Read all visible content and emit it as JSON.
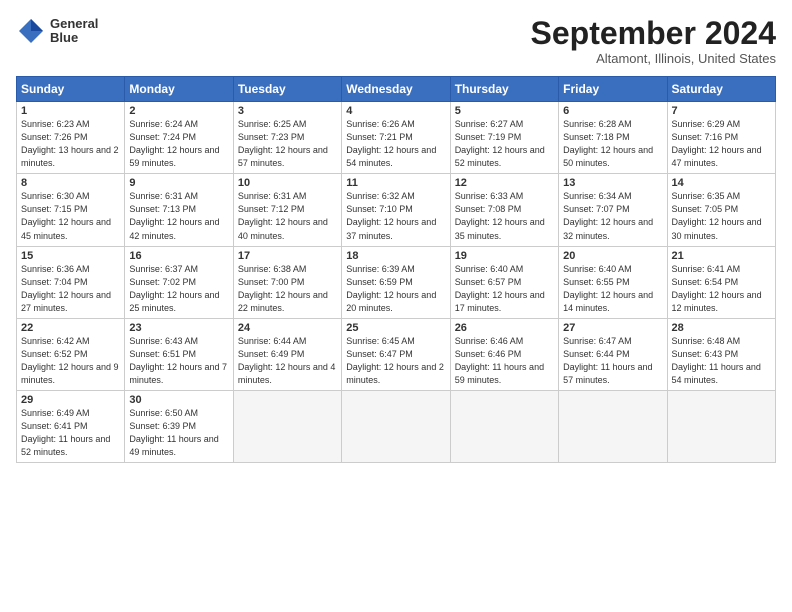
{
  "header": {
    "logo_line1": "General",
    "logo_line2": "Blue",
    "month_title": "September 2024",
    "location": "Altamont, Illinois, United States"
  },
  "weekdays": [
    "Sunday",
    "Monday",
    "Tuesday",
    "Wednesday",
    "Thursday",
    "Friday",
    "Saturday"
  ],
  "weeks": [
    [
      {
        "day": "1",
        "sunrise": "6:23 AM",
        "sunset": "7:26 PM",
        "daylight": "13 hours and 2 minutes."
      },
      {
        "day": "2",
        "sunrise": "6:24 AM",
        "sunset": "7:24 PM",
        "daylight": "12 hours and 59 minutes."
      },
      {
        "day": "3",
        "sunrise": "6:25 AM",
        "sunset": "7:23 PM",
        "daylight": "12 hours and 57 minutes."
      },
      {
        "day": "4",
        "sunrise": "6:26 AM",
        "sunset": "7:21 PM",
        "daylight": "12 hours and 54 minutes."
      },
      {
        "day": "5",
        "sunrise": "6:27 AM",
        "sunset": "7:19 PM",
        "daylight": "12 hours and 52 minutes."
      },
      {
        "day": "6",
        "sunrise": "6:28 AM",
        "sunset": "7:18 PM",
        "daylight": "12 hours and 50 minutes."
      },
      {
        "day": "7",
        "sunrise": "6:29 AM",
        "sunset": "7:16 PM",
        "daylight": "12 hours and 47 minutes."
      }
    ],
    [
      {
        "day": "8",
        "sunrise": "6:30 AM",
        "sunset": "7:15 PM",
        "daylight": "12 hours and 45 minutes."
      },
      {
        "day": "9",
        "sunrise": "6:31 AM",
        "sunset": "7:13 PM",
        "daylight": "12 hours and 42 minutes."
      },
      {
        "day": "10",
        "sunrise": "6:31 AM",
        "sunset": "7:12 PM",
        "daylight": "12 hours and 40 minutes."
      },
      {
        "day": "11",
        "sunrise": "6:32 AM",
        "sunset": "7:10 PM",
        "daylight": "12 hours and 37 minutes."
      },
      {
        "day": "12",
        "sunrise": "6:33 AM",
        "sunset": "7:08 PM",
        "daylight": "12 hours and 35 minutes."
      },
      {
        "day": "13",
        "sunrise": "6:34 AM",
        "sunset": "7:07 PM",
        "daylight": "12 hours and 32 minutes."
      },
      {
        "day": "14",
        "sunrise": "6:35 AM",
        "sunset": "7:05 PM",
        "daylight": "12 hours and 30 minutes."
      }
    ],
    [
      {
        "day": "15",
        "sunrise": "6:36 AM",
        "sunset": "7:04 PM",
        "daylight": "12 hours and 27 minutes."
      },
      {
        "day": "16",
        "sunrise": "6:37 AM",
        "sunset": "7:02 PM",
        "daylight": "12 hours and 25 minutes."
      },
      {
        "day": "17",
        "sunrise": "6:38 AM",
        "sunset": "7:00 PM",
        "daylight": "12 hours and 22 minutes."
      },
      {
        "day": "18",
        "sunrise": "6:39 AM",
        "sunset": "6:59 PM",
        "daylight": "12 hours and 20 minutes."
      },
      {
        "day": "19",
        "sunrise": "6:40 AM",
        "sunset": "6:57 PM",
        "daylight": "12 hours and 17 minutes."
      },
      {
        "day": "20",
        "sunrise": "6:40 AM",
        "sunset": "6:55 PM",
        "daylight": "12 hours and 14 minutes."
      },
      {
        "day": "21",
        "sunrise": "6:41 AM",
        "sunset": "6:54 PM",
        "daylight": "12 hours and 12 minutes."
      }
    ],
    [
      {
        "day": "22",
        "sunrise": "6:42 AM",
        "sunset": "6:52 PM",
        "daylight": "12 hours and 9 minutes."
      },
      {
        "day": "23",
        "sunrise": "6:43 AM",
        "sunset": "6:51 PM",
        "daylight": "12 hours and 7 minutes."
      },
      {
        "day": "24",
        "sunrise": "6:44 AM",
        "sunset": "6:49 PM",
        "daylight": "12 hours and 4 minutes."
      },
      {
        "day": "25",
        "sunrise": "6:45 AM",
        "sunset": "6:47 PM",
        "daylight": "12 hours and 2 minutes."
      },
      {
        "day": "26",
        "sunrise": "6:46 AM",
        "sunset": "6:46 PM",
        "daylight": "11 hours and 59 minutes."
      },
      {
        "day": "27",
        "sunrise": "6:47 AM",
        "sunset": "6:44 PM",
        "daylight": "11 hours and 57 minutes."
      },
      {
        "day": "28",
        "sunrise": "6:48 AM",
        "sunset": "6:43 PM",
        "daylight": "11 hours and 54 minutes."
      }
    ],
    [
      {
        "day": "29",
        "sunrise": "6:49 AM",
        "sunset": "6:41 PM",
        "daylight": "11 hours and 52 minutes."
      },
      {
        "day": "30",
        "sunrise": "6:50 AM",
        "sunset": "6:39 PM",
        "daylight": "11 hours and 49 minutes."
      },
      null,
      null,
      null,
      null,
      null
    ]
  ]
}
